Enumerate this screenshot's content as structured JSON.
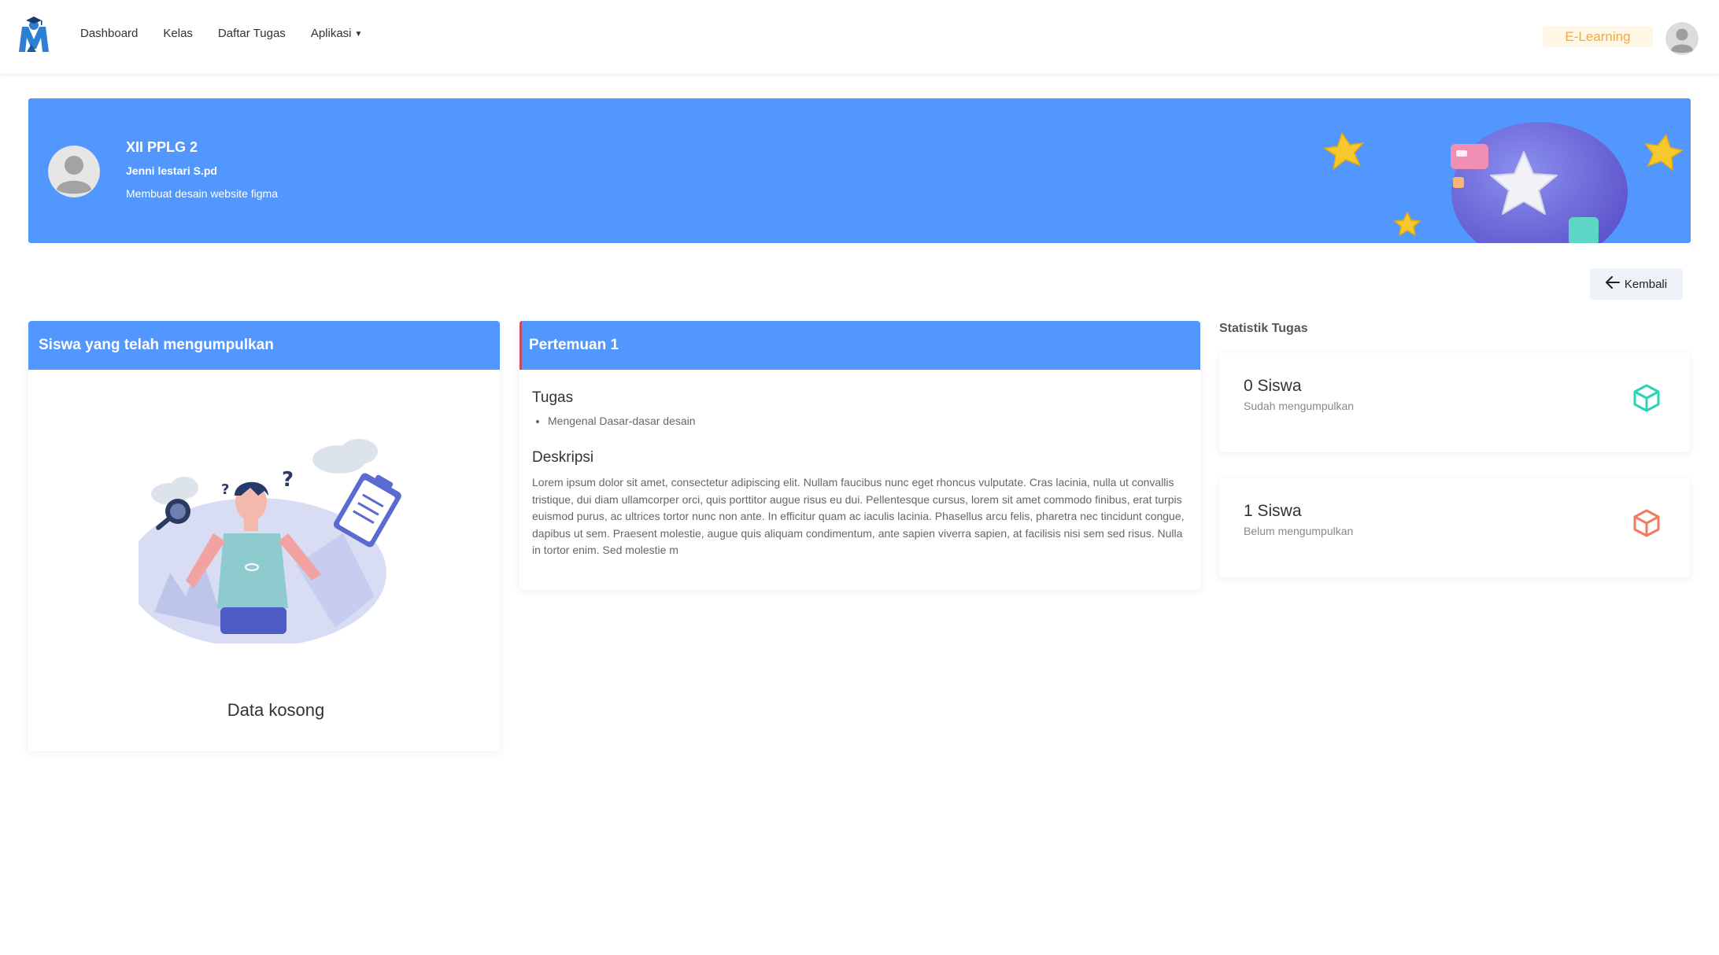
{
  "navbar": {
    "logo_icon": "graduate-m-logo-icon",
    "links": [
      {
        "label": "Dashboard"
      },
      {
        "label": "Kelas"
      },
      {
        "label": "Daftar Tugas"
      },
      {
        "label": "Aplikasi",
        "has_dropdown": true
      }
    ],
    "badge": "E-Learning",
    "badge_color": "#f5a93a",
    "avatar_icon": "user-avatar-icon"
  },
  "banner": {
    "class_name": "XII PPLG 2",
    "teacher": "Jenni lestari S.pd",
    "subject": "Membuat desain website figma",
    "background_color": "#5297fd"
  },
  "back_button": {
    "label": "Kembali",
    "icon": "arrow-left-icon"
  },
  "submitted_panel": {
    "title": "Siswa yang telah mengumpulkan",
    "empty_text": "Data kosong",
    "illustration_icon": "confused-person-illustration"
  },
  "meeting_panel": {
    "title": "Pertemuan 1",
    "task_heading": "Tugas",
    "tasks": [
      "Mengenal Dasar-dasar desain"
    ],
    "description_heading": "Deskripsi",
    "description": "Lorem ipsum dolor sit amet, consectetur adipiscing elit. Nullam faucibus nunc eget rhoncus vulputate. Cras lacinia, nulla ut convallis tristique, dui diam ullamcorper orci, quis porttitor augue risus eu dui. Pellentesque cursus, lorem sit amet commodo finibus, erat turpis euismod purus, ac ultrices tortor nunc non ante. In efficitur quam ac iaculis lacinia. Phasellus arcu felis, pharetra nec tincidunt congue, dapibus ut sem. Praesent molestie, augue quis aliquam condimentum, ante sapien viverra sapien, at facilisis nisi sem sed risus. Nulla in tortor enim. Sed molestie m"
  },
  "stats": {
    "title": "Statistik Tugas",
    "items": [
      {
        "value": "0 Siswa",
        "label": "Sudah mengumpulkan",
        "icon": "cube-icon",
        "color": "#2bd4b4"
      },
      {
        "value": "1 Siswa",
        "label": "Belum mengumpulkan",
        "icon": "cube-icon",
        "color": "#f27a5e"
      }
    ]
  }
}
